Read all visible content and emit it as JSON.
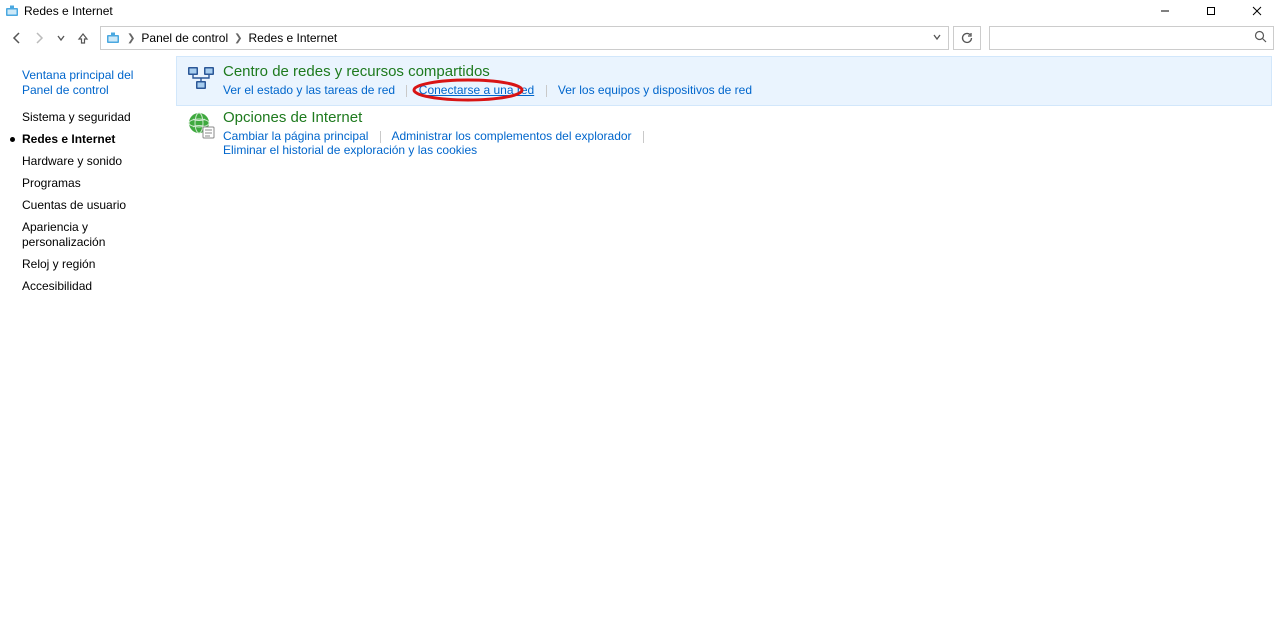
{
  "window": {
    "title": "Redes e Internet",
    "minimize_tip": "Minimize",
    "maximize_tip": "Maximize",
    "close_tip": "Close"
  },
  "nav": {
    "back_tip": "Back",
    "forward_tip": "Forward",
    "recent_tip": "Recent",
    "up_tip": "Up",
    "refresh_tip": "Refresh",
    "search_placeholder": ""
  },
  "breadcrumbs": {
    "root": "Panel de control",
    "current": "Redes e Internet"
  },
  "sidebar": {
    "home": "Ventana principal del Panel de control",
    "items": [
      {
        "label": "Sistema y seguridad",
        "active": false
      },
      {
        "label": "Redes e Internet",
        "active": true
      },
      {
        "label": "Hardware y sonido",
        "active": false
      },
      {
        "label": "Programas",
        "active": false
      },
      {
        "label": "Cuentas de usuario",
        "active": false
      },
      {
        "label": "Apariencia y personalización",
        "active": false
      },
      {
        "label": "Reloj y región",
        "active": false
      },
      {
        "label": "Accesibilidad",
        "active": false
      }
    ]
  },
  "panes": [
    {
      "title": "Centro de redes y recursos compartidos",
      "links": [
        "Ver el estado y las tareas de red",
        "Conectarse a una red",
        "Ver los equipos y dispositivos de red"
      ]
    },
    {
      "title": "Opciones de Internet",
      "links": [
        "Cambiar la página principal",
        "Administrar los complementos del explorador",
        "Eliminar el historial de exploración y las cookies"
      ]
    }
  ],
  "annotation": {
    "circled_link_index": 1
  }
}
